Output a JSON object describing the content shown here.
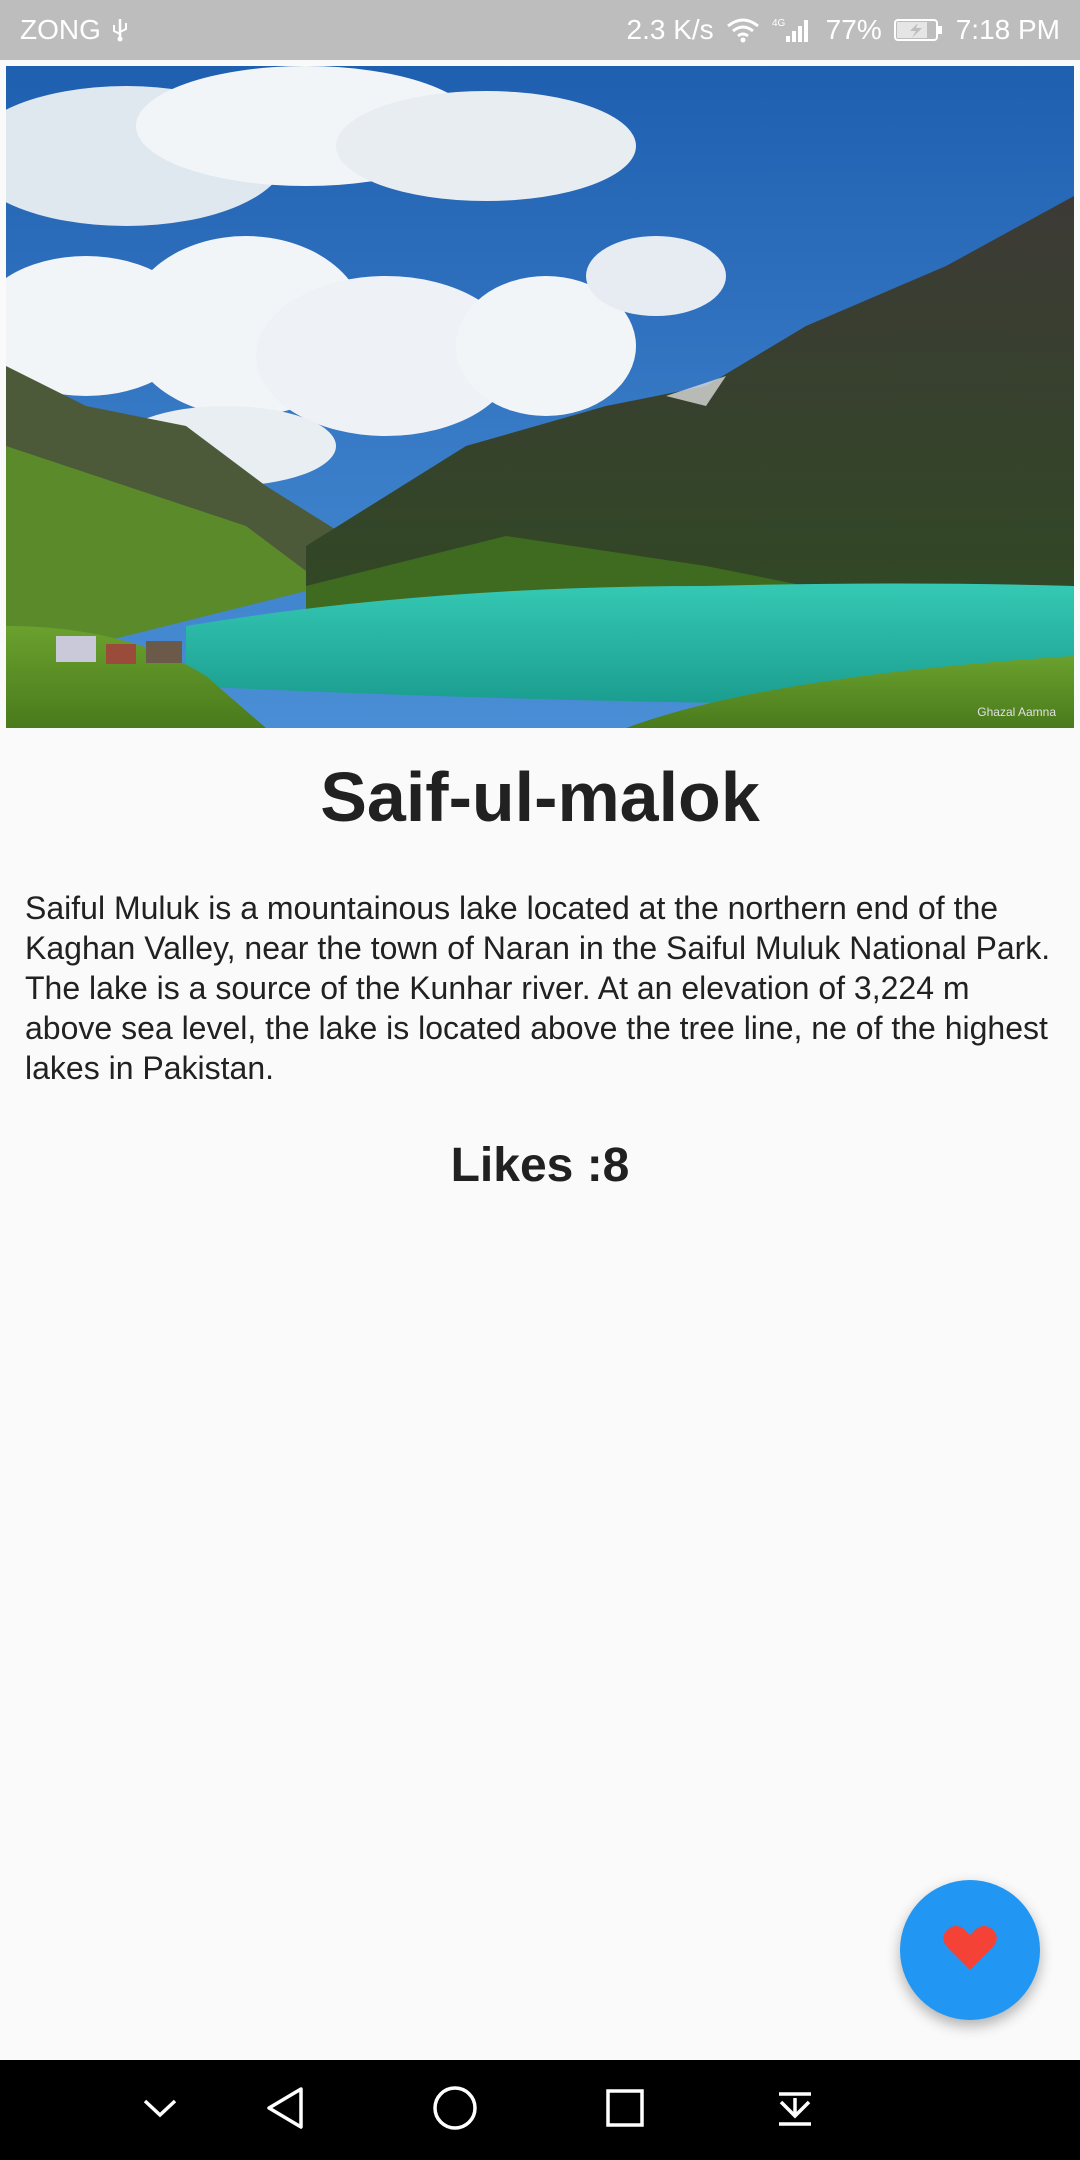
{
  "status_bar": {
    "carrier": "ZONG",
    "network_speed": "2.3 K/s",
    "network_type": "4G",
    "battery": "77%",
    "time": "7:18 PM"
  },
  "hero": {
    "icon": "landscape-photo",
    "watermark": "Ghazal Aamna"
  },
  "place": {
    "title": "Saif-ul-malok",
    "description": "Saiful Muluk is a mountainous lake located at the northern end of the Kaghan Valley, near the town of Naran in the Saiful Muluk National Park. The lake is a source of the Kunhar river. At an elevation of 3,224 m above sea level, the lake is located above the tree line, ne of the highest lakes in Pakistan.",
    "likes_label": "Likes :8"
  },
  "fab": {
    "icon": "heart-icon",
    "color": "#2196f3",
    "icon_color": "#f44336"
  },
  "nav_bar": {
    "buttons": [
      "collapse",
      "back",
      "home",
      "recents",
      "notifications-pull-down"
    ]
  }
}
